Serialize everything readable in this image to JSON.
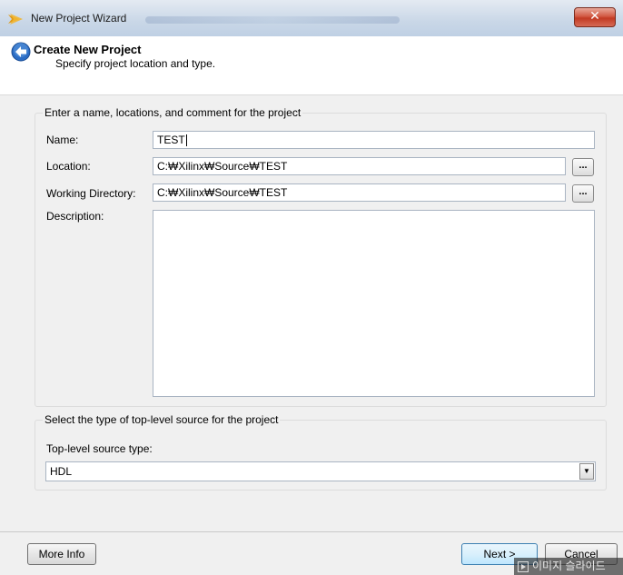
{
  "window": {
    "title": "New Project Wizard",
    "close_label": "✕"
  },
  "header": {
    "title": "Create New Project",
    "subtitle": "Specify project location and type."
  },
  "project_group": {
    "legend": "Enter a name, locations, and comment for the project",
    "name_label": "Name:",
    "name_value": "TEST",
    "location_label": "Location:",
    "location_value": "C:₩Xilinx₩Source₩TEST",
    "working_dir_label": "Working Directory:",
    "working_dir_value": "C:₩Xilinx₩Source₩TEST",
    "description_label": "Description:",
    "description_value": "",
    "browse_label": "..."
  },
  "source_group": {
    "legend": "Select the type of top-level source for the project",
    "type_label": "Top-level source type:",
    "type_value": "HDL"
  },
  "footer": {
    "more_info_label": "More Info",
    "next_label": "Next >",
    "cancel_label": "Cancel"
  },
  "overlay": {
    "text": "이미지 슬라이드"
  }
}
